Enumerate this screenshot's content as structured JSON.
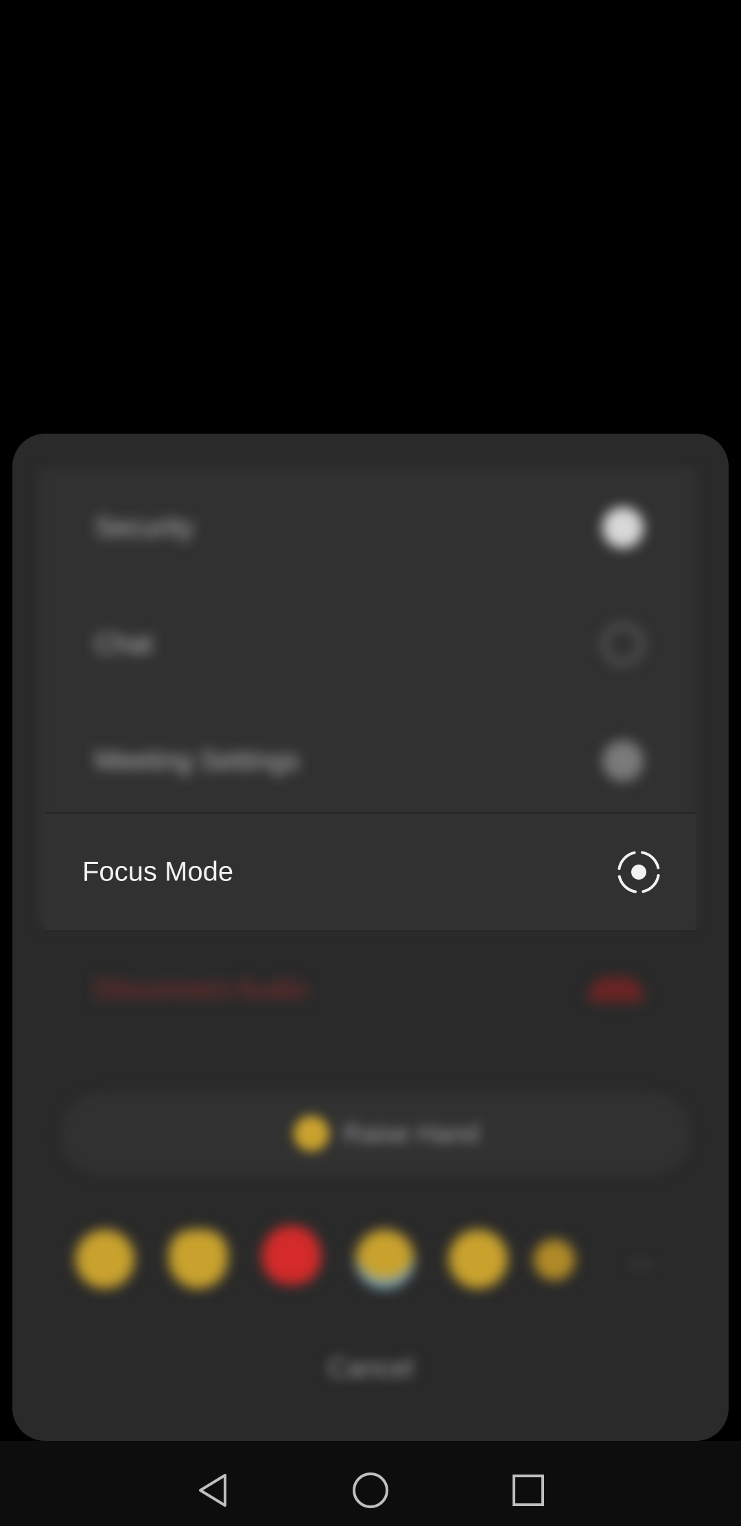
{
  "menu": {
    "items": [
      {
        "label": "Security",
        "icon": "security-badge-icon"
      },
      {
        "label": "Chat",
        "icon": "chat-bubble-icon"
      },
      {
        "label": "Meeting Settings",
        "icon": "settings-gear-icon"
      },
      {
        "label": "Focus Mode",
        "icon": "focus-mode-icon"
      },
      {
        "label": "Disconnect Audio",
        "icon": "headset-icon"
      }
    ],
    "raise_hand_label": "Raise Hand",
    "reactions": [
      "clapping-hands",
      "thumbs-up",
      "heart",
      "tears-of-joy",
      "open-mouth",
      "party-popper"
    ],
    "more_label": "...",
    "cancel_label": "Cancel"
  },
  "colors": {
    "danger": "#8a2b2b",
    "accent_yellow": "#c9a22e",
    "heart_red": "#d42a2a"
  },
  "navbar": {
    "buttons": [
      "back",
      "home",
      "recents"
    ]
  }
}
